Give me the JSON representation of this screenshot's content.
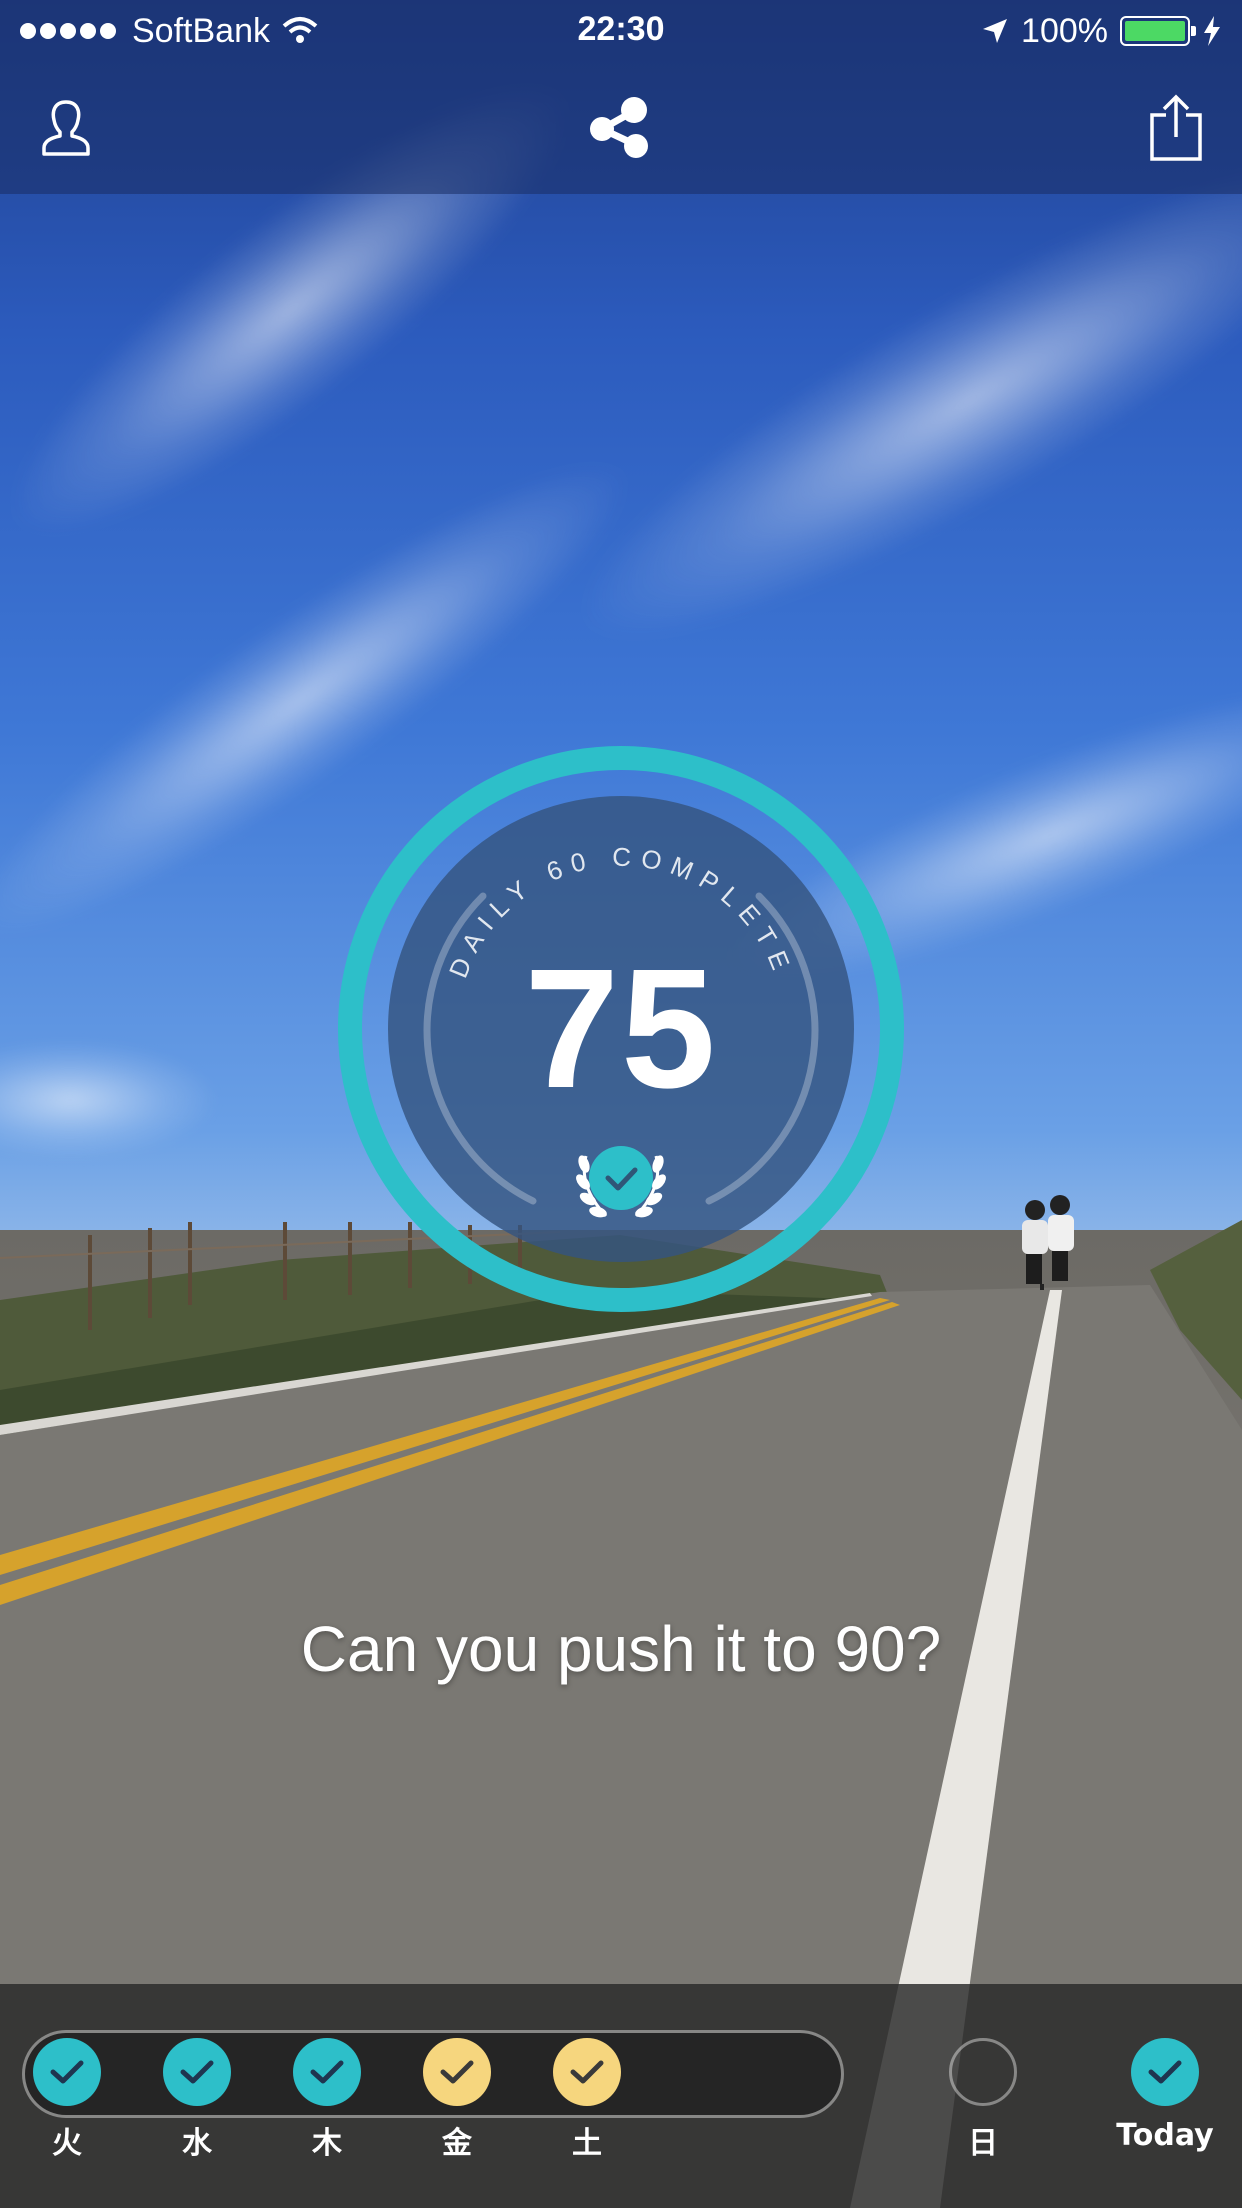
{
  "status_bar": {
    "carrier": "SoftBank",
    "time": "22:30",
    "battery": "100%"
  },
  "nav": {
    "profile_icon": "person-icon",
    "center_icon": "share-nodes-icon",
    "share_icon": "share-upload-icon"
  },
  "badge": {
    "label": "DAILY 60 COMPLETE",
    "score": "75",
    "ring_color": "#2dbfc9"
  },
  "prompt": "Can you push it to 90?",
  "week": {
    "days": [
      {
        "label": "火",
        "status": "complete-teal"
      },
      {
        "label": "水",
        "status": "complete-teal"
      },
      {
        "label": "木",
        "status": "complete-teal"
      },
      {
        "label": "金",
        "status": "complete-yellow"
      },
      {
        "label": "土",
        "status": "complete-yellow"
      },
      {
        "label": "日",
        "status": "empty"
      },
      {
        "label": "Today",
        "status": "complete-teal"
      }
    ],
    "colors": {
      "teal": "#2dbfc9",
      "yellow": "#f6d67e"
    }
  }
}
